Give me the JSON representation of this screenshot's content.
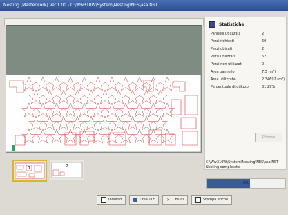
{
  "window": {
    "title": "Nesting [Masterwork] Ver.1.00 - C:\\Ww310W\\System\\Nesting\\NES\\asa.NST"
  },
  "stats": {
    "title": "Statistiche",
    "rows": [
      {
        "label": "Pannelli utilizzati",
        "value": "2"
      },
      {
        "label": "Pezzi richiesti",
        "value": "60"
      },
      {
        "label": "Pezzi ubicati",
        "value": "2"
      },
      {
        "label": "Pezzi utilizzati",
        "value": "62"
      },
      {
        "label": "Pezzi non utilizzati",
        "value": "0"
      },
      {
        "label": "Area pannello",
        "value": "7.5 (m²)"
      },
      {
        "label": "Area utilizzata",
        "value": "2.34692 (m²)"
      },
      {
        "label": "Percentuale di utilizzo",
        "value": "31.29%"
      }
    ]
  },
  "side_button": {
    "label": "Prinosa"
  },
  "status": {
    "path": "C:\\Ww310W\\System\\Nesting\\NES\\asa.NST",
    "message": "Nesting completato."
  },
  "progress": {
    "percent_label": "0%",
    "value": 0.55
  },
  "thumbnails": [
    {
      "number": "1"
    },
    {
      "number": "2"
    }
  ],
  "buttons": {
    "back": "Indietro",
    "create_tlf": "Crea TLF",
    "close": "Chiudi",
    "print_labels": "Stampa etiche"
  },
  "colors": {
    "title_bar": "#2c4f93",
    "sheet_bg": "#7f8c82",
    "part_outline": "#d13535",
    "selected_thumb": "#d7b72a",
    "progress_fill": "#3a5a9a"
  }
}
